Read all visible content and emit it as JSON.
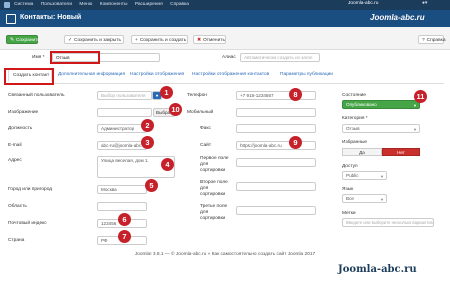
{
  "topnav": {
    "items": [
      "Система",
      "Пользователи",
      "Меню",
      "Компоненты",
      "Расширения",
      "Справка"
    ],
    "site": "Joomla-abc.ru",
    "user_icon": "user-icon"
  },
  "header": {
    "title": "Контакты: Новый",
    "brand": "Joomla-abc.ru"
  },
  "toolbar": {
    "save": "Сохранить",
    "save_close": "Сохранить и закрыть",
    "save_new": "Сохранить и создать",
    "cancel": "Отменить",
    "help": "Справка"
  },
  "form": {
    "name_label": "Имя *",
    "name_value": "Отзыв",
    "alias_label": "Алиас",
    "alias_placeholder": "Автоматически создать из загол"
  },
  "tabs": [
    "Создать контакт",
    "Дополнительная информация",
    "Настройки отображения",
    "Настройки отображения контактов",
    "Параметры публикации"
  ],
  "left": {
    "linked_user_label": "Связанный пользователь",
    "linked_user_placeholder": "Выбор пользователя",
    "image_label": "Изображение",
    "image_button": "Выбрать",
    "position_label": "Должность",
    "position_value": "Администратор",
    "email_label": "E-mail",
    "email_value": "abc-ru@joomla-abc.ru",
    "address_label": "Адрес",
    "address_value": "Улица веселая, дом 1.",
    "city_label": "Город или пригород",
    "city_value": "Москва",
    "region_label": "Область",
    "region_value": "",
    "postcode_label": "Почтовый индекс",
    "postcode_value": "123456",
    "country_label": "Страна",
    "country_value": "РФ"
  },
  "middle": {
    "phone_label": "Телефон",
    "phone_value": "+7 916-1234567",
    "mobile_label": "Мобильный",
    "fax_label": "Факс",
    "site_label": "Сайт",
    "site_value": "https://joomla-abc.ru",
    "sort1_label": "Первое поле для сортировки",
    "sort2_label": "Второе поле для сортировки",
    "sort3_label": "Третье поле для сортировки"
  },
  "right": {
    "status_label": "Состояние",
    "status_value": "Опубликовано",
    "category_label": "Категория *",
    "category_value": "Отзыв",
    "featured_label": "Избранные",
    "featured_yes": "Да",
    "featured_no": "Нет",
    "access_label": "Доступ",
    "access_value": "Public",
    "language_label": "Язык",
    "language_value": "Все",
    "tags_label": "Метки",
    "tags_placeholder": "Введите или выберите несколько вариантов"
  },
  "badges": [
    "1",
    "2",
    "3",
    "4",
    "5",
    "6",
    "7",
    "8",
    "9",
    "10",
    "11"
  ],
  "footer": "Joomla! 3.8.1 — © Joomla-abc.ru » Как самостоятельно создать сайт Joomla 2017",
  "watermark": "Joomla-abc.ru",
  "colors": {
    "badge": "#c6202a",
    "highlight": "#d01818",
    "status_green": "#46a546",
    "featured_no": "#c9302c",
    "header": "#1a4d80"
  }
}
